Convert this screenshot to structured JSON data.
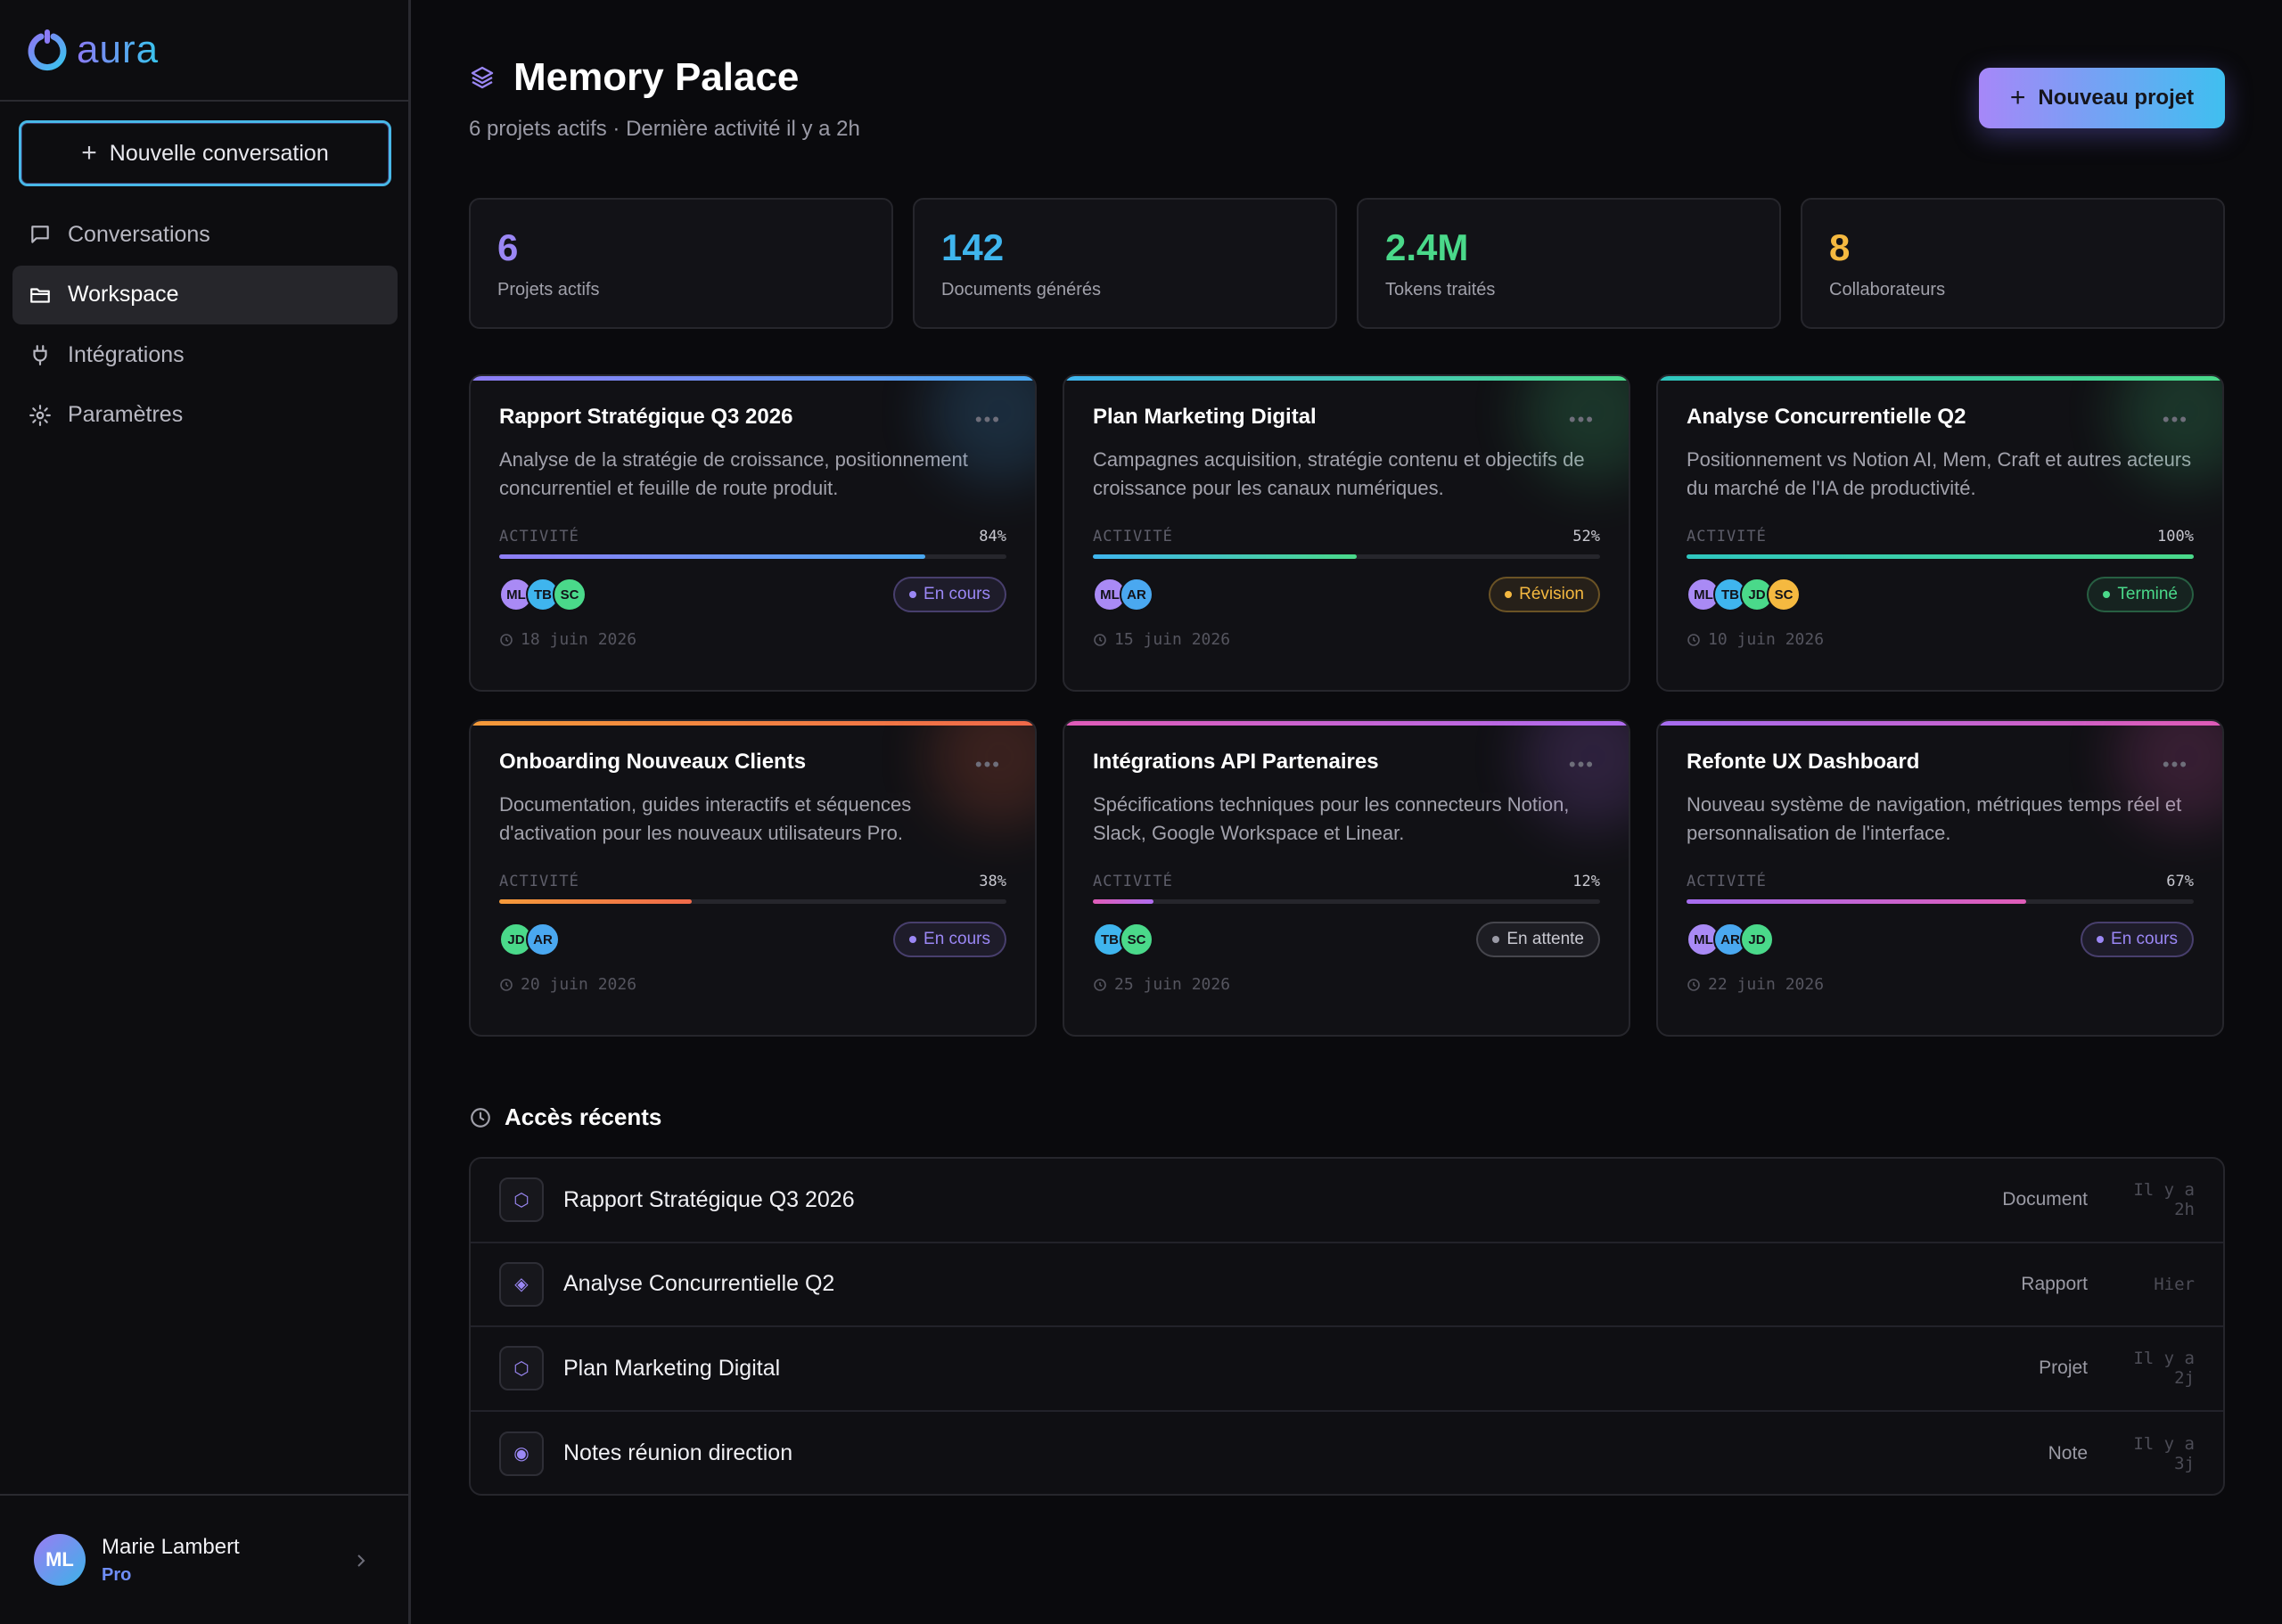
{
  "app": {
    "logo_text": "aura",
    "brand_colors": [
      "#8b7af5",
      "#38c5ee"
    ]
  },
  "sidebar": {
    "new_conversation": "Nouvelle conversation",
    "items": [
      {
        "label": "Conversations",
        "icon": "chat-icon",
        "active": false
      },
      {
        "label": "Workspace",
        "icon": "folder-icon",
        "active": true
      },
      {
        "label": "Intégrations",
        "icon": "plug-icon",
        "active": false
      },
      {
        "label": "Paramètres",
        "icon": "gear-icon",
        "active": false
      }
    ],
    "user": {
      "initials": "ML",
      "name": "Marie Lambert",
      "plan": "Pro"
    }
  },
  "header": {
    "title": "Memory Palace",
    "subtitle": "6 projets actifs · Dernière activité il y a 2h",
    "new_project": "Nouveau projet"
  },
  "stats": [
    {
      "value": "6",
      "label": "Projets actifs",
      "color": "#9b87f5"
    },
    {
      "value": "142",
      "label": "Documents générés",
      "color": "#3fb5ee"
    },
    {
      "value": "2.4M",
      "label": "Tokens traités",
      "color": "#4ad98a"
    },
    {
      "value": "8",
      "label": "Collaborateurs",
      "color": "#f5b940"
    }
  ],
  "activity_label": "ACTIVITÉ",
  "projects": [
    {
      "title": "Rapport Stratégique Q3 2026",
      "desc": "Analyse de la stratégie de croissance, positionnement concurrentiel et feuille de route produit.",
      "progress": 84,
      "progress_text": "84%",
      "accent": [
        "#8f7df5",
        "#4aa8f0"
      ],
      "avatars": [
        "ML",
        "TB",
        "SC"
      ],
      "status": "En cours",
      "status_color": "#9b87f5",
      "date": "18 juin 2026"
    },
    {
      "title": "Plan Marketing Digital",
      "desc": "Campagnes acquisition, stratégie contenu et objectifs de croissance pour les canaux numériques.",
      "progress": 52,
      "progress_text": "52%",
      "accent": [
        "#3fb5ee",
        "#4ad98a"
      ],
      "avatars": [
        "ML",
        "AR"
      ],
      "status": "Révision",
      "status_color": "#f5b940",
      "date": "15 juin 2026"
    },
    {
      "title": "Analyse Concurrentielle Q2",
      "desc": "Positionnement vs Notion AI, Mem, Craft et autres acteurs du marché de l'IA de productivité.",
      "progress": 100,
      "progress_text": "100%",
      "accent": [
        "#2fc7c0",
        "#4ad98a"
      ],
      "avatars": [
        "ML",
        "TB",
        "JD",
        "SC"
      ],
      "status": "Terminé",
      "status_color": "#4ad98a",
      "date": "10 juin 2026"
    },
    {
      "title": "Onboarding Nouveaux Clients",
      "desc": "Documentation, guides interactifs et séquences d'activation pour les nouveaux utilisateurs Pro.",
      "progress": 38,
      "progress_text": "38%",
      "accent": [
        "#f59a3a",
        "#f06a4a"
      ],
      "avatars": [
        "JD",
        "AR"
      ],
      "status": "En cours",
      "status_color": "#9b87f5",
      "date": "20 juin 2026"
    },
    {
      "title": "Intégrations API Partenaires",
      "desc": "Spécifications techniques pour les connecteurs Notion, Slack, Google Workspace et Linear.",
      "progress": 12,
      "progress_text": "12%",
      "accent": [
        "#e05cb8",
        "#b06df0"
      ],
      "avatars": [
        "TB",
        "SC"
      ],
      "status": "En attente",
      "status_color": "#9a9aa6",
      "date": "25 juin 2026"
    },
    {
      "title": "Refonte UX Dashboard",
      "desc": "Nouveau système de navigation, métriques temps réel et personnalisation de l'interface.",
      "progress": 67,
      "progress_text": "67%",
      "accent": [
        "#a66df0",
        "#e05cb8"
      ],
      "avatars": [
        "ML",
        "AR",
        "JD"
      ],
      "status": "En cours",
      "status_color": "#9b87f5",
      "date": "22 juin 2026"
    }
  ],
  "avatar_colors": {
    "ML": "#a98af5",
    "TB": "#3fb5ee",
    "SC": "#4ad98a",
    "AR": "#4aa8f0",
    "JD": "#4ad98a"
  },
  "avatar_colors_alt": {
    "card3_SC": "#f5b940"
  },
  "recent": {
    "title": "Accès récents",
    "items": [
      {
        "name": "Rapport Stratégique Q3 2026",
        "type": "Document",
        "time": "Il y a 2h",
        "icon": "hexagon-icon",
        "glyph": "⬡"
      },
      {
        "name": "Analyse Concurrentielle Q2",
        "type": "Rapport",
        "time": "Hier",
        "icon": "diamond-icon",
        "glyph": "◈"
      },
      {
        "name": "Plan Marketing Digital",
        "type": "Projet",
        "time": "Il y a 2j",
        "icon": "hexagon-icon",
        "glyph": "⬡"
      },
      {
        "name": "Notes réunion direction",
        "type": "Note",
        "time": "Il y a 3j",
        "icon": "dot-icon",
        "glyph": "◉"
      }
    ]
  }
}
